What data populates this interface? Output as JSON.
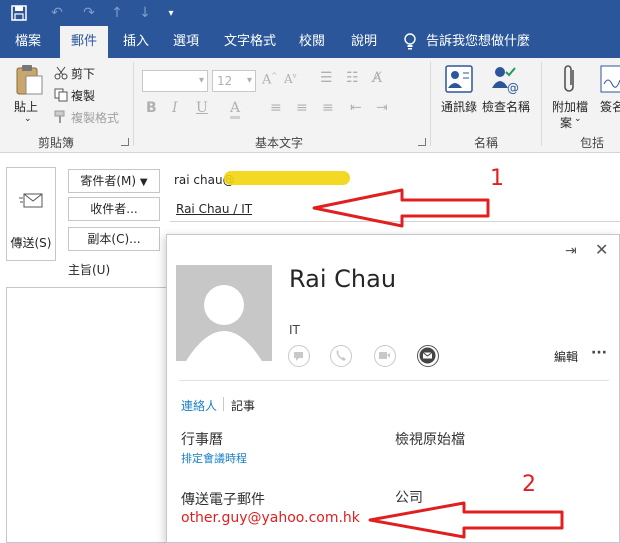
{
  "quick_access": {
    "icons": [
      "save-icon",
      "undo-icon",
      "redo-icon",
      "up-icon",
      "down-icon",
      "customize-icon"
    ]
  },
  "tabs": [
    {
      "label": "檔案",
      "active": false
    },
    {
      "label": "郵件",
      "active": true
    },
    {
      "label": "插入",
      "active": false
    },
    {
      "label": "選項",
      "active": false
    },
    {
      "label": "文字格式",
      "active": false
    },
    {
      "label": "校閱",
      "active": false
    },
    {
      "label": "說明",
      "active": false
    }
  ],
  "tell_me": "告訴我您想做什麼",
  "ribbon": {
    "clipboard": {
      "paste": "貼上",
      "cut": "剪下",
      "copy": "複製",
      "format_painter": "複製格式",
      "group_label": "剪貼簿"
    },
    "basic_text": {
      "font_size": "12",
      "bold": "B",
      "italic": "I",
      "underline": "U",
      "font_color": "A",
      "group_label": "基本文字"
    },
    "names": {
      "address_book": "通訊錄",
      "check_names": "檢查名稱",
      "group_label": "名稱"
    },
    "include": {
      "attach_file": "附加檔",
      "attach_file_2": "案",
      "signature": "簽名",
      "group_label": "包括"
    }
  },
  "compose": {
    "send": "傳送(S)",
    "from_button": "寄件者(M)",
    "from_value": "rai    chau@",
    "to_button": "收件者...",
    "to_value": "Rai    Chau / IT",
    "cc_button": "副本(C)...",
    "subject_label": "主旨(U)"
  },
  "contact_card": {
    "name": "Rai    Chau",
    "department": "IT",
    "edit": "編輯",
    "more": "···",
    "tabs": [
      "連絡人",
      "記事"
    ],
    "calendar_label": "行事曆",
    "schedule_link": "排定會議時程",
    "view_source": "檢視原始檔",
    "send_email_label": "傳送電子郵件",
    "email": "other.guy@yahoo.com.hk",
    "company_label": "公司"
  },
  "annotations": {
    "marker_1": "1",
    "marker_2": "2"
  },
  "colors": {
    "brand_blue": "#2b579a",
    "link_blue": "#1a82c4",
    "annotation_red": "#e02020"
  }
}
